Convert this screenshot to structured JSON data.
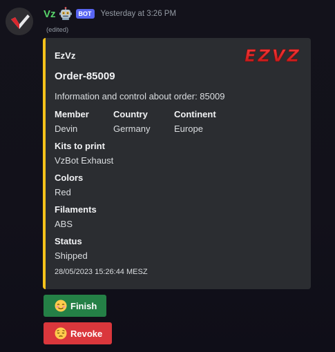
{
  "message": {
    "author": {
      "username": "Vz",
      "bot_badge": "BOT",
      "avatar_icon": "vzbot-logo-icon",
      "emoji_icon": "robot-emoji-icon"
    },
    "timestamp": "Yesterday at 3:26 PM",
    "edited_label": "(edited)"
  },
  "embed": {
    "accent_color": "#f6c31b",
    "author": "EzVz",
    "logo_text": "EZVZ",
    "title": "Order-85009",
    "description": "Information and control about order: 85009",
    "fields": {
      "member": {
        "name": "Member",
        "value": "Devin"
      },
      "country": {
        "name": "Country",
        "value": "Germany"
      },
      "continent": {
        "name": "Continent",
        "value": "Europe"
      },
      "kits": {
        "name": "Kits to print",
        "value": "VzBot Exhaust"
      },
      "colors": {
        "name": "Colors",
        "value": "Red"
      },
      "filaments": {
        "name": "Filaments",
        "value": "ABS"
      },
      "status": {
        "name": "Status",
        "value": "Shipped"
      }
    },
    "footer": "28/05/2023 15:26:44 MESZ"
  },
  "buttons": {
    "finish": {
      "label": "Finish",
      "color": "#248046",
      "icon": "relieved-face-emoji-icon"
    },
    "revoke": {
      "label": "Revoke",
      "color": "#da373c",
      "icon": "pensive-face-emoji-icon"
    }
  }
}
